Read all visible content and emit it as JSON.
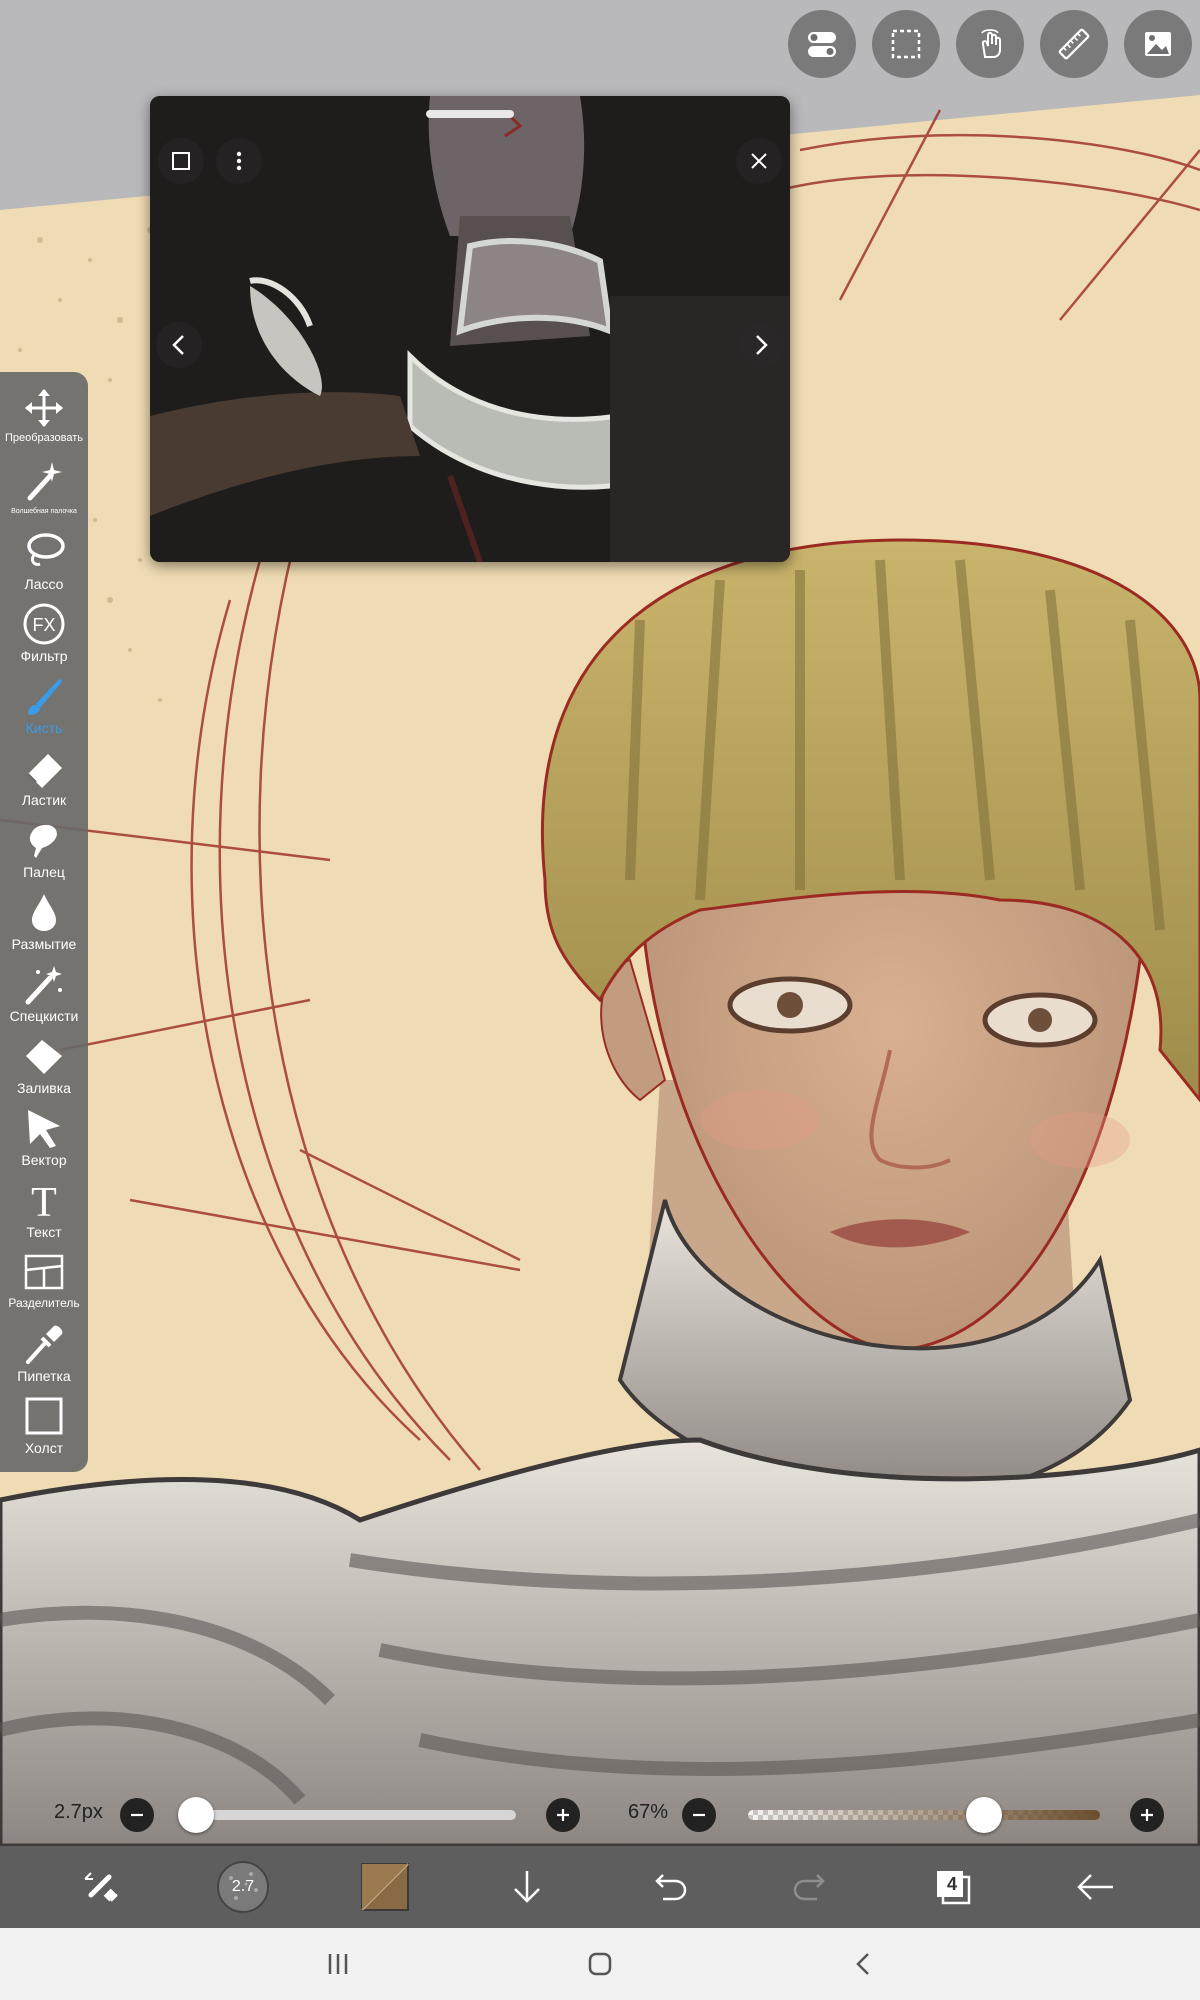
{
  "colors": {
    "accent": "#3a9be8",
    "canvas_paper": "#f0dcb4",
    "sketch_line": "#9b2a22",
    "toolbar_bg": "#696969",
    "action_bar_bg": "#5e5e5e",
    "nav_bar_bg": "#f2f2f2"
  },
  "top_toolbar": {
    "buttons": [
      {
        "icon": "toggle-settings-icon"
      },
      {
        "icon": "selection-icon"
      },
      {
        "icon": "hand-touch-icon"
      },
      {
        "icon": "ruler-icon"
      },
      {
        "icon": "image-reference-icon"
      }
    ]
  },
  "reference_window": {
    "icons": [
      "window-mode-icon",
      "more-vertical-icon",
      "close-icon",
      "previous-icon",
      "next-icon"
    ]
  },
  "tools": [
    {
      "label": "Преобразовать",
      "icon": "move-transform-icon"
    },
    {
      "label": "Волшебная палочка",
      "icon": "magic-wand-icon"
    },
    {
      "label": "Лассо",
      "icon": "lasso-icon"
    },
    {
      "label": "Фильтр",
      "icon": "fx-filter-icon"
    },
    {
      "label": "Кисть",
      "icon": "brush-icon",
      "active": true
    },
    {
      "label": "Ластик",
      "icon": "eraser-icon"
    },
    {
      "label": "Палец",
      "icon": "smudge-finger-icon"
    },
    {
      "label": "Размытие",
      "icon": "blur-drop-icon"
    },
    {
      "label": "Спецкисти",
      "icon": "special-brush-icon"
    },
    {
      "label": "Заливка",
      "icon": "fill-bucket-icon"
    },
    {
      "label": "Вектор",
      "icon": "vector-cursor-icon"
    },
    {
      "label": "Текст",
      "icon": "text-icon"
    },
    {
      "label": "Разделитель",
      "icon": "frame-divider-icon"
    },
    {
      "label": "Пипетка",
      "icon": "eyedropper-icon"
    },
    {
      "label": "Холст",
      "icon": "canvas-icon"
    }
  ],
  "brush_size": {
    "value": 2.7,
    "label": "2.7px",
    "min_fraction": 0.0
  },
  "opacity": {
    "value": 67,
    "label": "67%",
    "fraction": 0.67
  },
  "action_bar": {
    "brush_preview_label": "2.7",
    "layers_count": "4",
    "current_color": "#8a6a45",
    "icons": [
      "swap-tools-icon",
      "brush-preview-icon",
      "color-swatch-icon",
      "download-icon",
      "undo-icon",
      "redo-icon",
      "layers-icon",
      "back-arrow-icon"
    ]
  },
  "navigation": {
    "icons": [
      "recent-apps-icon",
      "home-icon",
      "back-icon"
    ]
  }
}
